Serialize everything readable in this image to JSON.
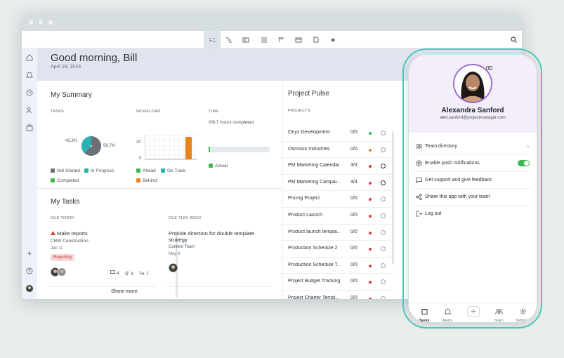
{
  "header": {
    "greeting": "Good morning, Bill",
    "date": "April 29, 2024"
  },
  "summary": {
    "title": "My Summary",
    "tasks_label": "TASKS",
    "workload_label": "WORKLOAD",
    "time_label": "TIME",
    "pie": {
      "left_pct": "43.3%",
      "right_pct": "56.7%"
    },
    "workload_ticks": [
      "20",
      "0"
    ],
    "time_text": "0/6.7 hours completed",
    "time_legend": "Actual",
    "task_legend": [
      "Not Started",
      "In Progress",
      "Completed"
    ],
    "workload_legend": [
      "Ahead",
      "On Track",
      "Behind"
    ],
    "colors": {
      "not_started": "#6b7177",
      "in_progress": "#2ab3b1",
      "completed": "#43b650",
      "behind": "#e8841e"
    }
  },
  "my_tasks": {
    "title": "My Tasks",
    "due_today_label": "DUE TODAY",
    "due_week_label": "DUE THIS WEEK",
    "card1": {
      "title": "Make reports",
      "project": "CRW Construction",
      "date": "Jan 11",
      "tag": "Reporting",
      "comments": "4",
      "attachments": "4",
      "subtasks": "1"
    },
    "card2": {
      "title": "Provide direction for double template strategy",
      "project": "Content Team",
      "date": "May 3"
    },
    "show_more": "Show more"
  },
  "pulse": {
    "title": "Project Pulse",
    "projects_label": "PROJECTS",
    "rows": [
      {
        "name": "Onyx Development",
        "count": "0/0",
        "status": "#3bb34d"
      },
      {
        "name": "Osmosis Industries",
        "count": "0/0",
        "status": "#e8851c"
      },
      {
        "name": "PM Marketing Calendar",
        "count": "3/3",
        "status": "#d93b3b"
      },
      {
        "name": "PM Marketing Campai...",
        "count": "4/4",
        "status": "#d93b3b"
      },
      {
        "name": "Pricing Project",
        "count": "0/0",
        "status": "#d93b3b"
      },
      {
        "name": "Product Launch",
        "count": "0/0",
        "status": "#d93b3b"
      },
      {
        "name": "Product launch templa...",
        "count": "0/0",
        "status": "#d93b3b"
      },
      {
        "name": "Production Schedule 2",
        "count": "0/0",
        "status": "#d93b3b"
      },
      {
        "name": "Production Schedule T...",
        "count": "0/0",
        "status": "#d93b3b"
      },
      {
        "name": "Project Budget Tracking",
        "count": "0/0",
        "status": "#d93b3b"
      },
      {
        "name": "Project Charter Templ...",
        "count": "0/0",
        "status": "#d93b3b"
      }
    ]
  },
  "phone": {
    "name": "Alexandra Sanford",
    "email": "aled.sanford@projectmanager.com",
    "menu": [
      {
        "label": "Team directory",
        "icon": "team-icon"
      },
      {
        "label": "Enable push notifications",
        "icon": "at-icon"
      },
      {
        "label": "Get support and give feedback",
        "icon": "chat-icon"
      },
      {
        "label": "Share this app with your team",
        "icon": "share-icon"
      },
      {
        "label": "Log out",
        "icon": "logout-icon"
      }
    ],
    "tabs": [
      "Tasks",
      "Alerts",
      "Team",
      "Settings"
    ],
    "accent": "#4ec7c0"
  }
}
